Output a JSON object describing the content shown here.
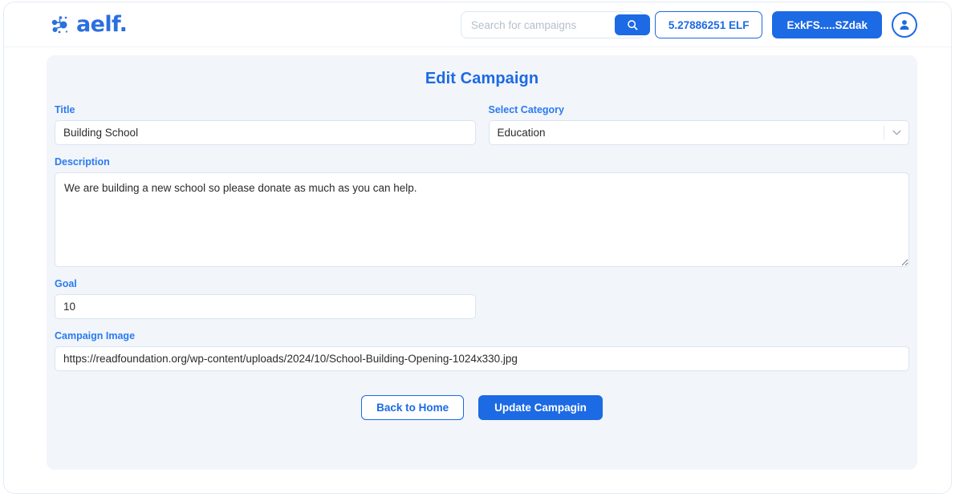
{
  "window": {
    "brand_name": "aelf.",
    "brand_icon": "aelf-dots-logo-icon"
  },
  "topbar": {
    "search": {
      "placeholder": "Search for campaigns",
      "value": "",
      "button_icon": "search-icon"
    },
    "balance": "5.27886251 ELF",
    "wallet_address": "ExkFS.....SZdak",
    "avatar_icon": "user-avatar-icon",
    "accent_color": "#1c6ae4"
  },
  "main": {
    "page_title": "Edit Campaign",
    "card_background": "#f2f5fa",
    "label_color": "#2a7bf0",
    "fields": {
      "title": {
        "label": "Title",
        "value": "Building School",
        "placeholder": ""
      },
      "category": {
        "label": "Select Category",
        "value": "Education",
        "arrow_icon": "chevron-down-icon"
      },
      "description": {
        "label": "Description",
        "value": "We are building a new school so please donate as much as you can help.",
        "placeholder": ""
      },
      "goal": {
        "label": "Goal",
        "value": "10",
        "placeholder": ""
      },
      "campaign_image": {
        "label": "Campaign Image",
        "value": "https://readfoundation.org/wp-content/uploads/2024/10/School-Building-Opening-1024x330.jpg",
        "placeholder": ""
      }
    },
    "buttons": {
      "back": "Back to Home",
      "update": "Update Campagin"
    }
  }
}
